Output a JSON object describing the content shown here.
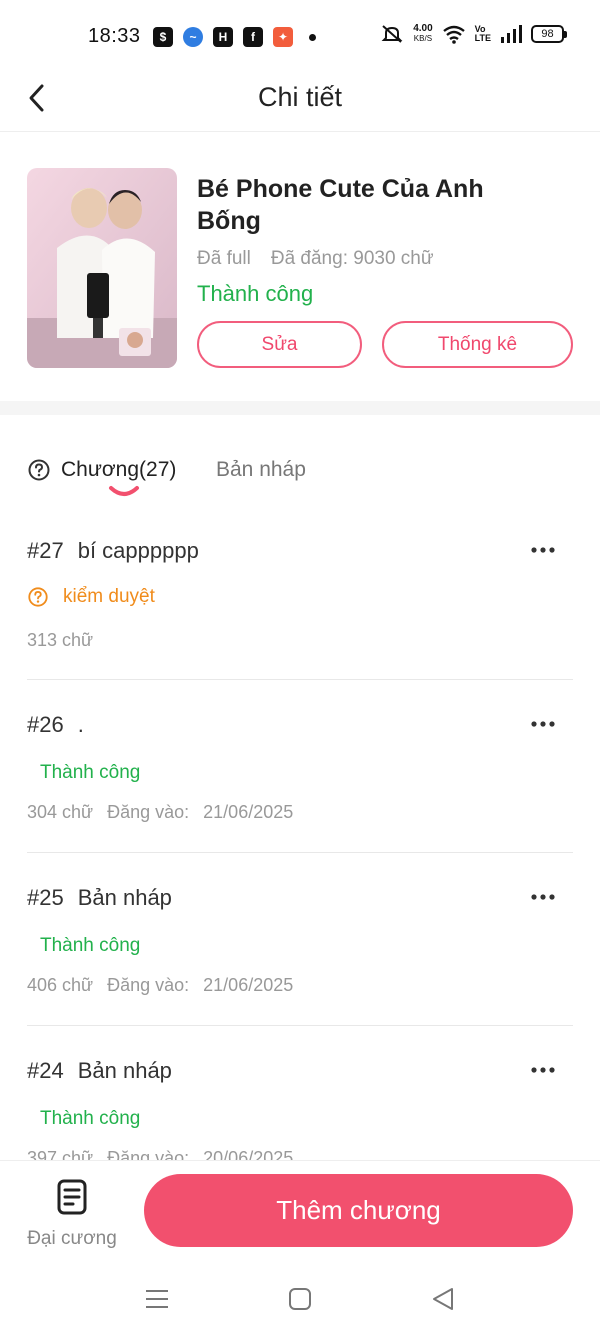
{
  "status_bar": {
    "time": "18:33",
    "net_speed_value": "4.00",
    "net_speed_unit": "KB/S",
    "volte_top": "Vo",
    "volte_bottom": "LTE",
    "battery": "98"
  },
  "header": {
    "title": "Chi tiết"
  },
  "book": {
    "title": "Bé Phone Cute Của Anh Bống",
    "completion": "Đã full",
    "published_words": "Đã đăng: 9030 chữ",
    "status": "Thành công",
    "edit_label": "Sửa",
    "stats_label": "Thống kê"
  },
  "tabs": {
    "chapters_label": "Chương(27)",
    "drafts_label": "Bản nháp"
  },
  "chapters": [
    {
      "number": "#27",
      "title": "bí capppppp",
      "state": "kiểm duyệt",
      "words": "313 chữ",
      "published_label": "",
      "date": ""
    },
    {
      "number": "#26",
      "title": ".",
      "state": "Thành công",
      "words": "304 chữ",
      "published_label": "Đăng vào:",
      "date": "21/06/2025"
    },
    {
      "number": "#25",
      "title": "Bản nháp",
      "state": "Thành công",
      "words": "406 chữ",
      "published_label": "Đăng vào:",
      "date": "21/06/2025"
    },
    {
      "number": "#24",
      "title": "Bản nháp",
      "state": "Thành công",
      "words": "397 chữ",
      "published_label": "Đăng vào:",
      "date": "20/06/2025"
    }
  ],
  "bottom": {
    "outline_label": "Đại cương",
    "add_chapter_label": "Thêm chương"
  },
  "colors": {
    "accent": "#f2506e",
    "success": "#22b14c",
    "review": "#f08c1c"
  }
}
